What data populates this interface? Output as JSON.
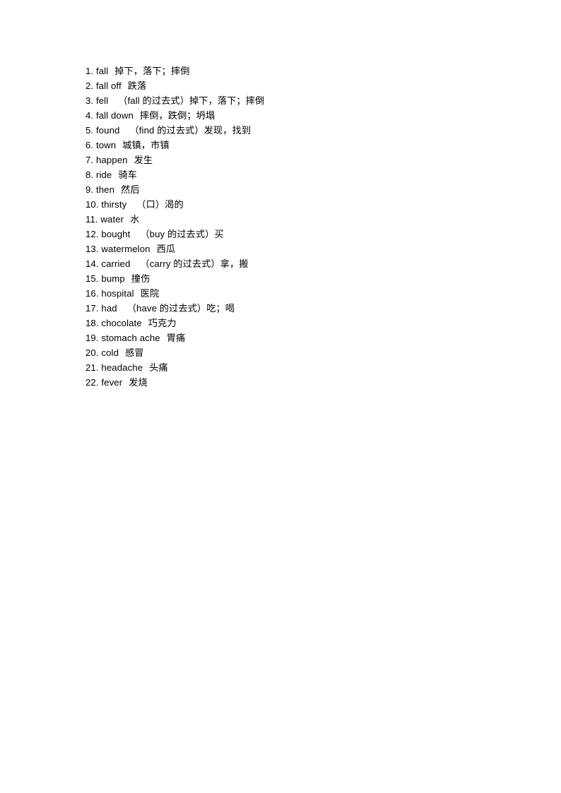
{
  "document": {
    "kind": "vocabulary-word-list",
    "page_background": "#ffffff",
    "text_color": "#000000",
    "page_number_visible": false
  },
  "list": {
    "entries": [
      {
        "index": "1.",
        "term": "fall",
        "note": "",
        "gloss": "掉下，落下；摔倒"
      },
      {
        "index": "2.",
        "term": "fall off",
        "note": "",
        "gloss": "跌落"
      },
      {
        "index": "3.",
        "term": "fell",
        "note": "（fall 的过去式）",
        "gloss": "掉下，落下；摔倒"
      },
      {
        "index": "4.",
        "term": "fall down",
        "note": "",
        "gloss": "摔倒，跌倒；坍塌"
      },
      {
        "index": "5.",
        "term": "found",
        "note": "（find 的过去式）",
        "gloss": "发现，找到"
      },
      {
        "index": "6.",
        "term": "town",
        "note": "",
        "gloss": "城镇，市镇"
      },
      {
        "index": "7.",
        "term": "happen",
        "note": "",
        "gloss": "发生"
      },
      {
        "index": "8.",
        "term": "ride",
        "note": "",
        "gloss": "骑车"
      },
      {
        "index": "9.",
        "term": "then",
        "note": "",
        "gloss": "然后"
      },
      {
        "index": "10.",
        "term": "thirsty",
        "note": "（口）",
        "gloss": "渴的"
      },
      {
        "index": "11.",
        "term": "water",
        "note": "",
        "gloss": "水"
      },
      {
        "index": "12.",
        "term": "bought",
        "note": "（buy 的过去式）",
        "gloss": "买"
      },
      {
        "index": "13.",
        "term": "watermelon",
        "note": "",
        "gloss": "西瓜"
      },
      {
        "index": "14.",
        "term": "carried",
        "note": "（carry 的过去式）",
        "gloss": "拿，搬"
      },
      {
        "index": "15.",
        "term": "bump",
        "note": "",
        "gloss": "撞伤"
      },
      {
        "index": "16.",
        "term": "hospital",
        "note": "",
        "gloss": "医院"
      },
      {
        "index": "17.",
        "term": "had",
        "note": "（have 的过去式）",
        "gloss": "吃；喝"
      },
      {
        "index": "18.",
        "term": "chocolate",
        "note": "",
        "gloss": "巧克力"
      },
      {
        "index": "19.",
        "term": "stomach ache",
        "note": "",
        "gloss": "胃痛"
      },
      {
        "index": "20.",
        "term": "cold",
        "note": "",
        "gloss": "感冒"
      },
      {
        "index": "21.",
        "term": "headache",
        "note": "",
        "gloss": "头痛"
      },
      {
        "index": "22.",
        "term": "fever",
        "note": "",
        "gloss": "发烧"
      }
    ]
  }
}
